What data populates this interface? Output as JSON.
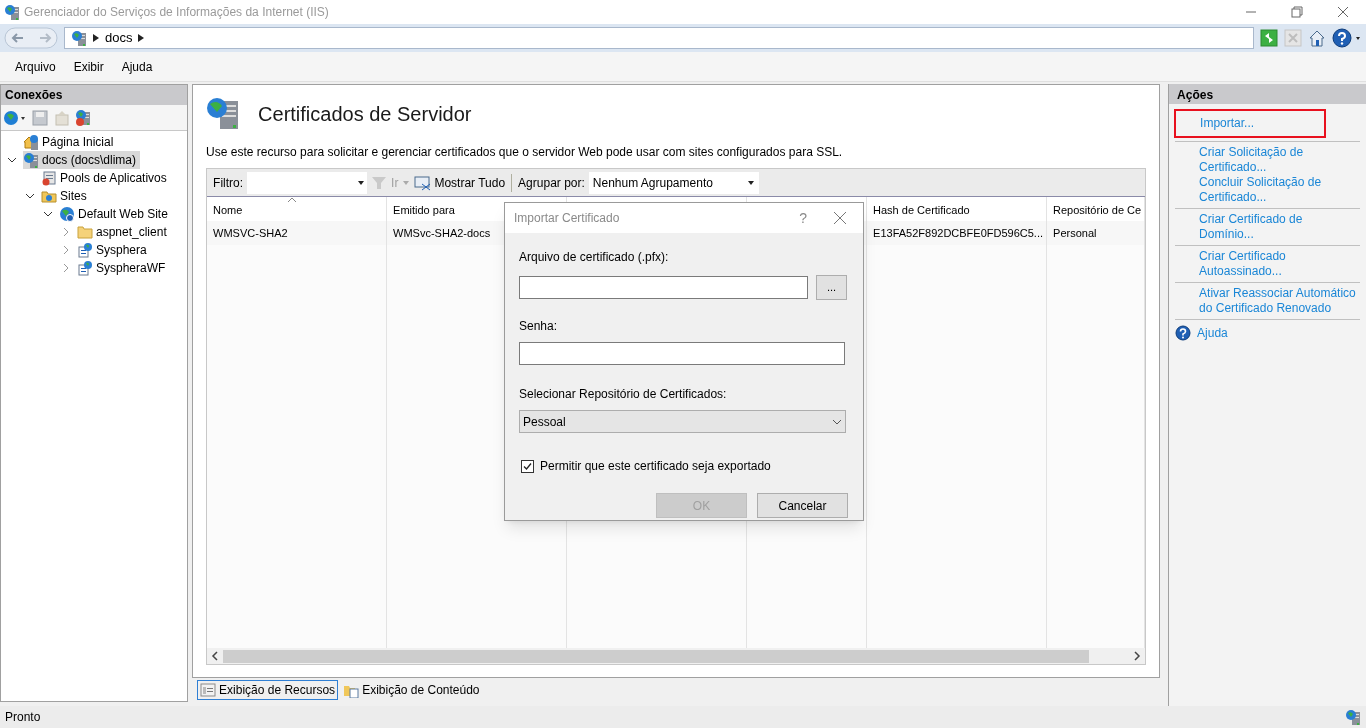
{
  "window": {
    "title": "Gerenciador do Serviços de Informações da Internet (IIS)"
  },
  "address": {
    "crumbs": [
      "docs"
    ]
  },
  "menu": [
    {
      "label": "Arquivo"
    },
    {
      "label": "Exibir"
    },
    {
      "label": "Ajuda"
    }
  ],
  "connections": {
    "title": "Conexões",
    "tree": [
      {
        "label": "Página Inicial",
        "kind": "home",
        "selected": false
      },
      {
        "label": "docs (docs\\dlima)",
        "kind": "server",
        "selected": true,
        "expanded": true,
        "children": [
          {
            "label": "Pools de Aplicativos",
            "kind": "pool",
            "selected": false
          },
          {
            "label": "Sites",
            "kind": "sites",
            "selected": false,
            "expanded": true,
            "children": [
              {
                "label": "Default Web Site",
                "kind": "site",
                "selected": false,
                "expanded": true,
                "children": [
                  {
                    "label": "aspnet_client",
                    "kind": "folder",
                    "selected": false,
                    "expanded": false
                  },
                  {
                    "label": "Sysphera",
                    "kind": "app",
                    "selected": false,
                    "expanded": false
                  },
                  {
                    "label": "SyspheraWF",
                    "kind": "app",
                    "selected": false,
                    "expanded": false
                  }
                ]
              }
            ]
          }
        ]
      }
    ]
  },
  "content": {
    "title": "Certificados de Servidor",
    "description": "Use este recurso para solicitar e gerenciar certificados que o servidor Web pode usar com sites configurados para SSL.",
    "filter": {
      "label": "Filtro:",
      "go": "Ir",
      "show_all": "Mostrar Tudo",
      "group_label": "Agrupar por:",
      "group_value": "Nenhum Agrupamento"
    },
    "table": {
      "columns": [
        {
          "label": "Nome"
        },
        {
          "label": "Emitido para"
        },
        {},
        {},
        {
          "label": "Hash de Certificado"
        },
        {
          "label": "Repositório de Ce"
        }
      ],
      "rows": [
        [
          "WMSVC-SHA2",
          "WMSvc-SHA2-docs",
          "",
          "",
          "E13FA52F892DCBFE0FD596C5...",
          "Personal"
        ]
      ]
    }
  },
  "view_tabs": [
    {
      "label": "Exibição de Recursos",
      "selected": true
    },
    {
      "label": "Exibição de Conteúdo",
      "selected": false
    }
  ],
  "actions": {
    "title": "Ações",
    "groups": [
      [
        {
          "label": "Importar...",
          "highlighted": true
        }
      ],
      [
        {
          "label": "Criar Solicitação de Certificado...",
          "highlighted": false
        },
        {
          "label": "Concluir Solicitação de Certificado...",
          "highlighted": false
        }
      ],
      [
        {
          "label": "Criar Certificado de Domínio...",
          "highlighted": false
        }
      ],
      [
        {
          "label": "Criar Certificado Autoassinado...",
          "highlighted": false
        }
      ],
      [
        {
          "label": "Ativar Reassociar Automático do Certificado Renovado",
          "highlighted": false
        }
      ]
    ],
    "help": "Ajuda"
  },
  "dialog": {
    "title": "Importar Certificado",
    "help": "?",
    "file_label": "Arquivo de certificado (.pfx):",
    "browse": "...",
    "password_label": "Senha:",
    "store_label": "Selecionar Repositório de Certificados:",
    "store_value": "Pessoal",
    "exportable": {
      "label": "Permitir que este certificado seja exportado",
      "checked": true
    },
    "ok": {
      "label": "OK",
      "disabled": true
    },
    "cancel": {
      "label": "Cancelar",
      "disabled": false
    }
  },
  "status_bar": {
    "text": "Pronto"
  }
}
